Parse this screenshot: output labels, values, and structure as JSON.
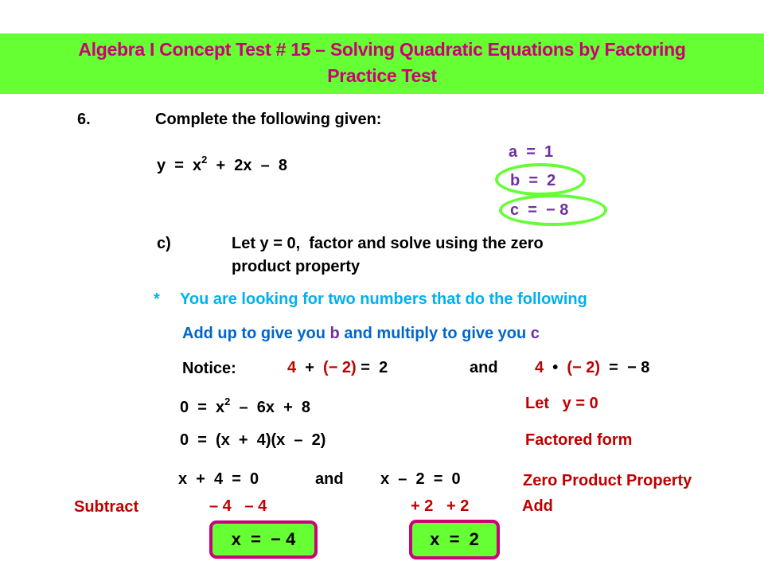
{
  "header": {
    "title_line1": "Algebra I Concept Test # 15 – Solving Quadratic Equations by Factoring",
    "title_line2": "Practice Test",
    "background_color": "#66ff33",
    "text_color": "#cc0077"
  },
  "problem": {
    "number": "6.",
    "instruction": "Complete the following given:",
    "equation": {
      "prefix": "y  =  x",
      "exponent": "2",
      "suffix": "  +  2x  –  8"
    },
    "coefficients": {
      "a": "a  =  1",
      "b": "b  =  2",
      "c": "c  =  − 8"
    }
  },
  "part_c": {
    "label": "c)",
    "instruction_line1": "Let y = 0,  factor and solve using the zero",
    "instruction_line2": "product property"
  },
  "hint": {
    "bullet": "*",
    "line1": "You are looking for two numbers that do the following",
    "line2_a": "Add up to give you ",
    "line2_b": "b",
    "line2_c": " and multiply to give you ",
    "line2_d": "c"
  },
  "notice": {
    "label": "Notice:",
    "sum": {
      "n1": "4",
      "op": "  +  ",
      "n2": "(− 2)",
      "result": " =  2"
    },
    "connector": "and",
    "product": {
      "n1": "4",
      "op": "  •  ",
      "n2": "(− 2)",
      "result": "  =  − 8"
    }
  },
  "steps": [
    {
      "equation_prefix": "0  =  x",
      "equation_exponent": "2",
      "equation_suffix": "  –  6x  +  8",
      "note": "Let   y = 0"
    },
    {
      "equation": "0  =  (x  +  4)(x  –  2)",
      "note": "Factored form"
    },
    {
      "left": "x  +  4  =  0",
      "connector": "and",
      "right": "x  –  2  =  0",
      "note": "Zero Product Property"
    }
  ],
  "solve": {
    "left_operation_label": "Subtract",
    "left_operation": "– 4   – 4",
    "right_operation": "+ 2   + 2",
    "right_operation_label": "Add",
    "solution_1": "x  =  − 4",
    "solution_2": "x  =  2"
  }
}
